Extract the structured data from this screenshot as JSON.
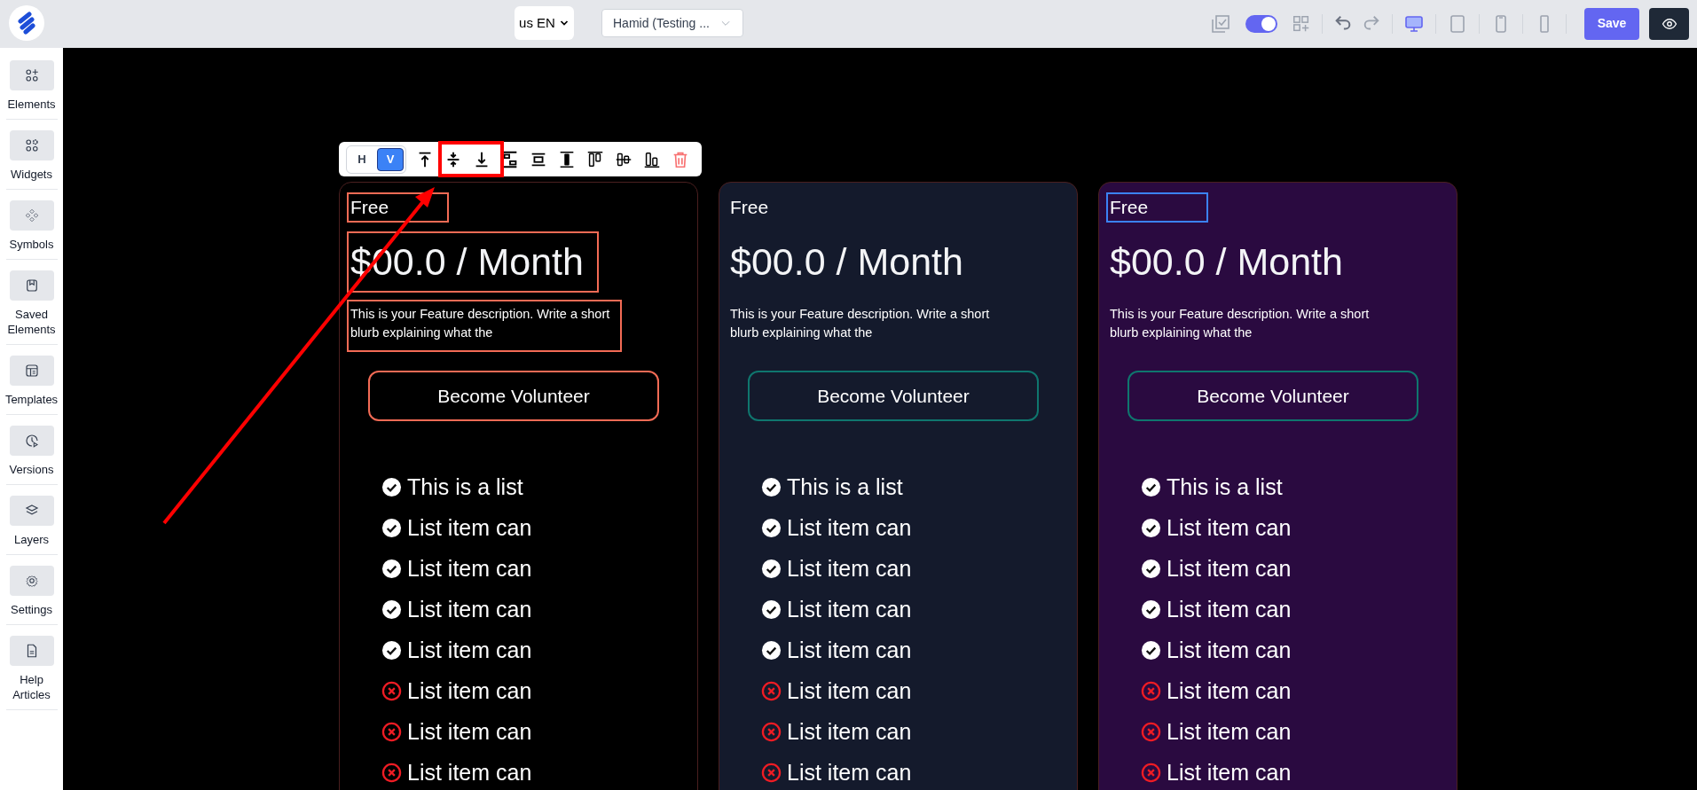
{
  "topbar": {
    "language": "us EN",
    "project": "Hamid (Testing ...",
    "toggle_on": true,
    "devices": [
      {
        "kind": "desktop",
        "selected": true
      },
      {
        "kind": "tablet",
        "selected": false
      },
      {
        "kind": "phone",
        "selected": false
      },
      {
        "kind": "small-phone",
        "selected": false
      }
    ],
    "save": "Save"
  },
  "sidebar": {
    "items": [
      {
        "label": "Elements"
      },
      {
        "label": "Widgets"
      },
      {
        "label": "Symbols"
      },
      {
        "label": "Saved Elements"
      },
      {
        "label": "Templates"
      },
      {
        "label": "Versions"
      },
      {
        "label": "Layers"
      },
      {
        "label": "Settings"
      },
      {
        "label": "Help Articles"
      }
    ]
  },
  "toolbar": {
    "orientation": [
      {
        "label": "H",
        "selected": false
      },
      {
        "label": "V",
        "selected": true
      }
    ]
  },
  "cards": [
    {
      "color": "#000000",
      "selected": true,
      "title_hovered": false,
      "title": "Free",
      "price": "$00.0 / Month",
      "description": "This is your Feature description. Write a short blurb explaining what the",
      "button": "Become Volunteer",
      "items": [
        {
          "kind": "check",
          "text": "This is a list"
        },
        {
          "kind": "check",
          "text": "List item can"
        },
        {
          "kind": "check",
          "text": "List item can"
        },
        {
          "kind": "check",
          "text": "List item can"
        },
        {
          "kind": "check",
          "text": "List item can"
        },
        {
          "kind": "cross",
          "text": "List item can"
        },
        {
          "kind": "cross",
          "text": "List item can"
        },
        {
          "kind": "cross",
          "text": "List item can"
        }
      ]
    },
    {
      "color": "#141a2c",
      "selected": false,
      "title_hovered": false,
      "title": "Free",
      "price": "$00.0 / Month",
      "description": "This is your Feature description. Write a short blurb explaining what the",
      "button": "Become Volunteer",
      "items": [
        {
          "kind": "check",
          "text": "This is a list"
        },
        {
          "kind": "check",
          "text": "List item can"
        },
        {
          "kind": "check",
          "text": "List item can"
        },
        {
          "kind": "check",
          "text": "List item can"
        },
        {
          "kind": "check",
          "text": "List item can"
        },
        {
          "kind": "cross",
          "text": "List item can"
        },
        {
          "kind": "cross",
          "text": "List item can"
        },
        {
          "kind": "cross",
          "text": "List item can"
        }
      ]
    },
    {
      "color": "#2a0a40",
      "selected": false,
      "title_hovered": true,
      "title": "Free",
      "price": "$00.0 / Month",
      "description": "This is your Feature description. Write a short blurb explaining what the",
      "button": "Become Volunteer",
      "items": [
        {
          "kind": "check",
          "text": "This is a list"
        },
        {
          "kind": "check",
          "text": "List item can"
        },
        {
          "kind": "check",
          "text": "List item can"
        },
        {
          "kind": "check",
          "text": "List item can"
        },
        {
          "kind": "check",
          "text": "List item can"
        },
        {
          "kind": "cross",
          "text": "List item can"
        },
        {
          "kind": "cross",
          "text": "List item can"
        },
        {
          "kind": "cross",
          "text": "List item can"
        }
      ]
    }
  ]
}
